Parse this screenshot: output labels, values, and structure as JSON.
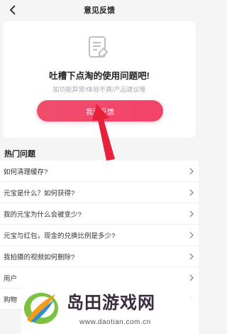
{
  "header": {
    "title": "意见反馈"
  },
  "card": {
    "headline": "吐槽下点淘的使用问题吧!",
    "subline": "如功能异常/体验不爽/产品建议等",
    "button_label": "我要反馈"
  },
  "hot": {
    "title": "热门问题",
    "items": [
      {
        "q": "如何清理缓存?"
      },
      {
        "q": "元宝是什么？如何获得?"
      },
      {
        "q": "我的元宝为什么会被变少?"
      },
      {
        "q": "元宝与红包，现金的兑换比例是多少?"
      },
      {
        "q": "我拍摄的视频如何删除?"
      },
      {
        "q": "用户"
      },
      {
        "q": "购物"
      }
    ]
  },
  "watermark": {
    "brand": "岛田游戏网",
    "url": "www.daotian.com.cn"
  },
  "colors": {
    "accent": "#ef4d6c",
    "arrow": "#e8203a"
  }
}
